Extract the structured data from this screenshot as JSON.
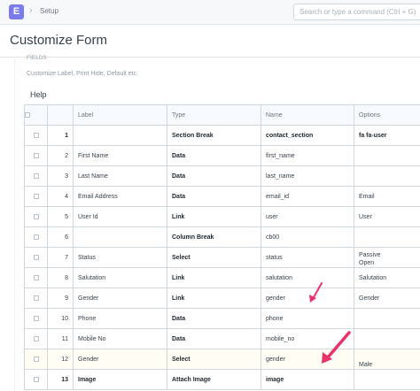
{
  "navbar": {
    "logo": "E",
    "breadcrumb": "Setup",
    "search_placeholder": "Search or type a command (Ctrl + G)"
  },
  "page": {
    "title": "Customize Form",
    "section_label": "FIELDS",
    "section_desc": "Customize Label, Print Hide, Default etc.",
    "help": "Help"
  },
  "table": {
    "headers": [
      "Label",
      "Type",
      "Name",
      "Options"
    ],
    "rows": [
      {
        "idx": "1",
        "label": "",
        "type": "Section Break",
        "name": "contact_section",
        "options": "fa fa-user"
      },
      {
        "idx": "2",
        "label": "First Name",
        "type": "Data",
        "name": "first_name",
        "options": ""
      },
      {
        "idx": "3",
        "label": "Last Name",
        "type": "Data",
        "name": "last_name",
        "options": ""
      },
      {
        "idx": "4",
        "label": "Email Address",
        "type": "Data",
        "name": "email_id",
        "options": "Email"
      },
      {
        "idx": "5",
        "label": "User Id",
        "type": "Link",
        "name": "user",
        "options": "User"
      },
      {
        "idx": "6",
        "label": "",
        "type": "Column Break",
        "name": "cb00",
        "options": ""
      },
      {
        "idx": "7",
        "label": "Status",
        "type": "Select",
        "name": "status",
        "options": "Passive\nOpen"
      },
      {
        "idx": "8",
        "label": "Salutation",
        "type": "Link",
        "name": "salutation",
        "options": "Salutation"
      },
      {
        "idx": "9",
        "label": "Gender",
        "type": "Link",
        "name": "gender",
        "options": "Gender"
      },
      {
        "idx": "10",
        "label": "Phone",
        "type": "Data",
        "name": "phone",
        "options": ""
      },
      {
        "idx": "11",
        "label": "Mobile No",
        "type": "Data",
        "name": "mobile_no",
        "options": ""
      },
      {
        "idx": "12",
        "label": "Gender",
        "type": "Select",
        "name": "gender",
        "options": "Male"
      },
      {
        "idx": "13",
        "label": "Image",
        "type": "Attach Image",
        "name": "image",
        "options": ""
      }
    ]
  },
  "colors": {
    "accent": "#7b7bea",
    "arrow": "#e8336b",
    "border": "#d1d8dd"
  }
}
